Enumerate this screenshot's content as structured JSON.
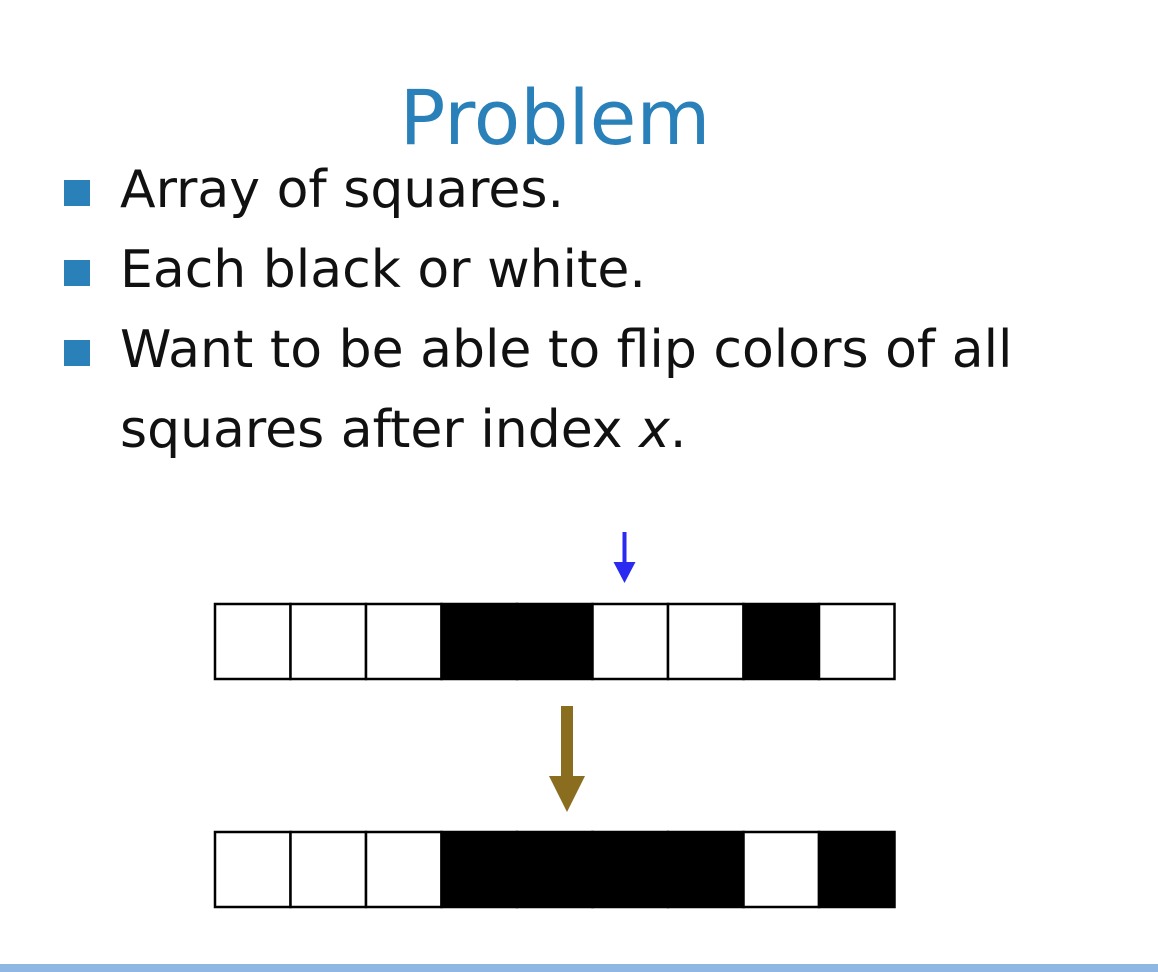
{
  "slide": {
    "title": "Problem",
    "bullets": [
      {
        "text": "Array of squares."
      },
      {
        "text": "Each black or white."
      },
      {
        "text_prefix": "Want to be able to flip colors of all squares after index ",
        "variable": "x",
        "text_suffix": "."
      }
    ]
  },
  "diagram": {
    "before": [
      "white",
      "white",
      "white",
      "black",
      "black",
      "white",
      "white",
      "black",
      "white"
    ],
    "after": [
      "white",
      "white",
      "white",
      "black",
      "black",
      "black",
      "black",
      "white",
      "black"
    ],
    "pointer_after_cell": 5,
    "colors": {
      "pointer": "#2a2af0",
      "transform_arrow": "#8a6d1f",
      "title": "#2a80b9",
      "bullet": "#2a80b9"
    }
  }
}
